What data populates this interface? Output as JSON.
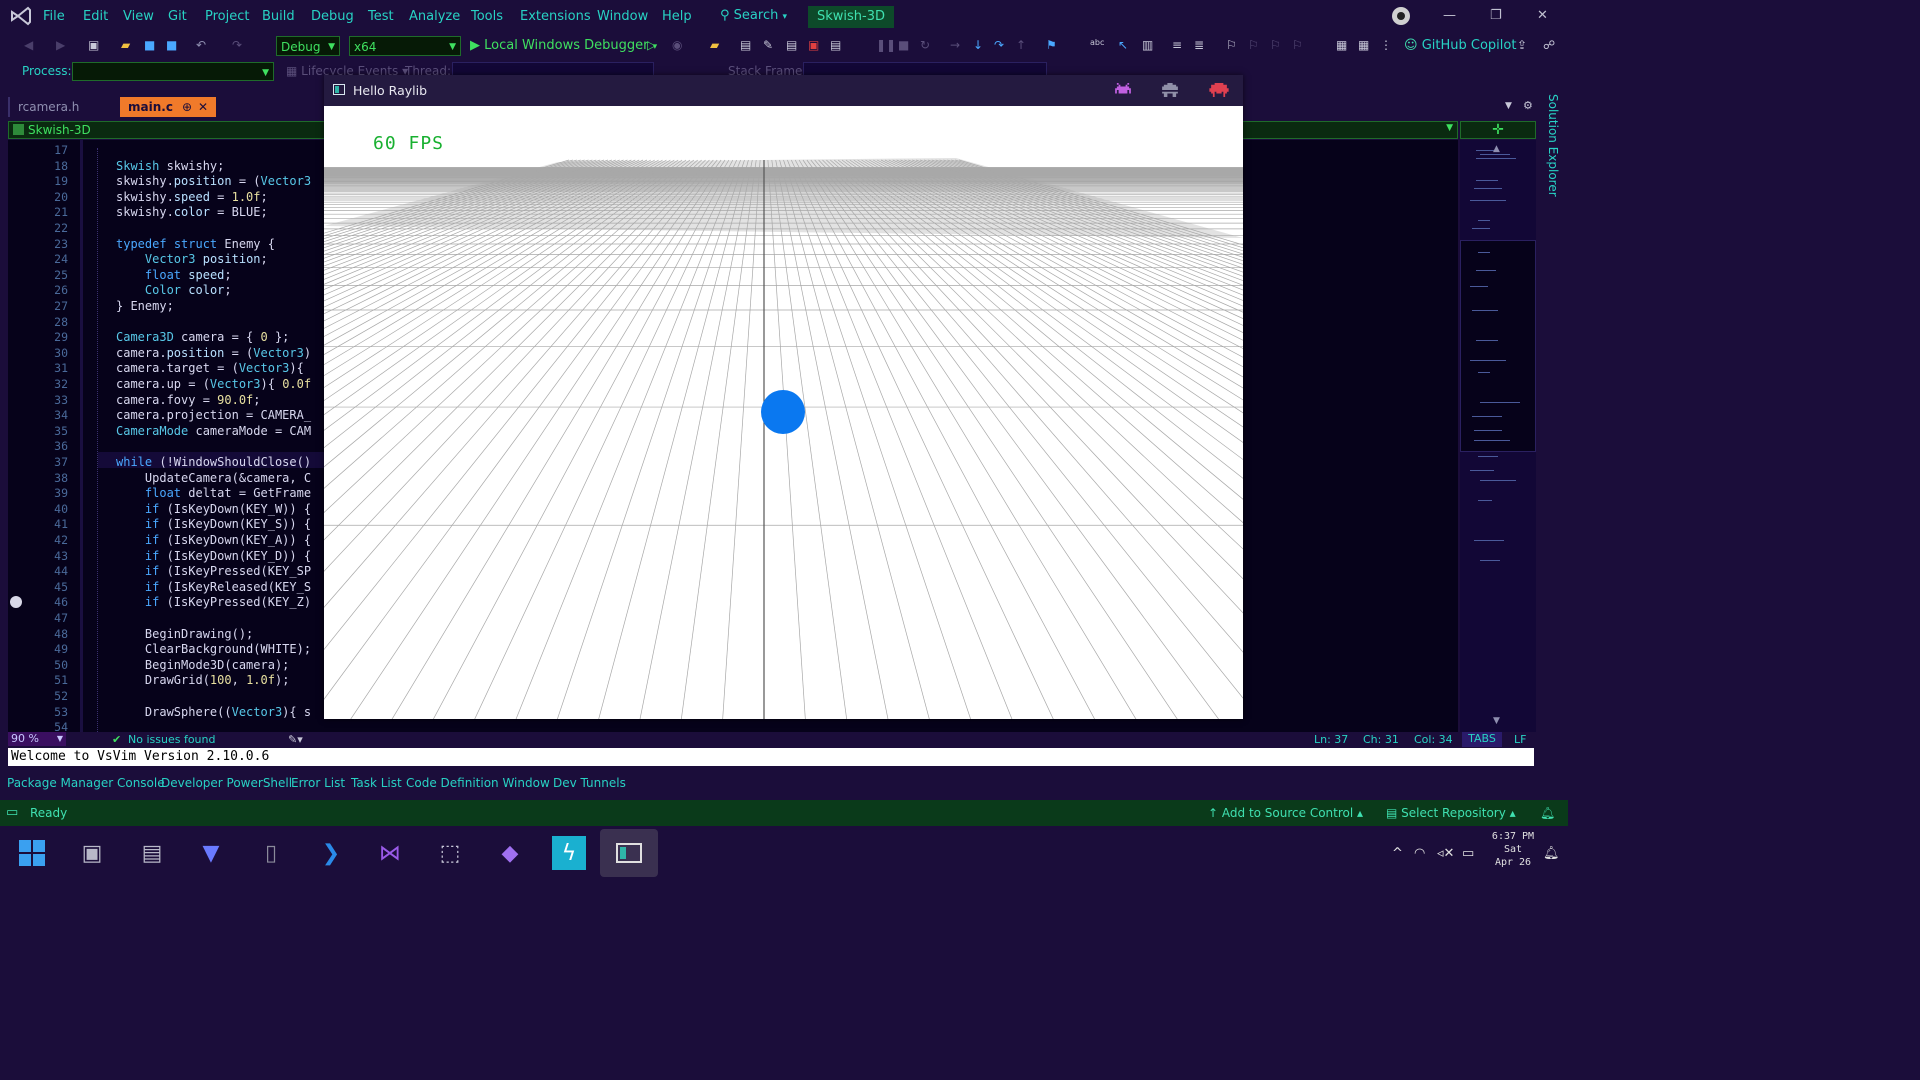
{
  "menubar": {
    "items": [
      "File",
      "Edit",
      "View",
      "Git",
      "Project",
      "Build",
      "Debug",
      "Test",
      "Analyze",
      "Tools",
      "Extensions",
      "Window",
      "Help"
    ],
    "search_label": "Search",
    "project_name": "Skwish-3D"
  },
  "toolbar": {
    "config": "Debug",
    "platform": "x64",
    "debugger": "Local Windows Debugger",
    "copilot": "GitHub Copilot"
  },
  "toolbar2": {
    "process_label": "Process:",
    "lifecycle_label": "Lifecycle Events",
    "thread_label": "Thread:",
    "stack_label": "Stack Frame:"
  },
  "tabs": [
    {
      "label": "rcamera.h"
    },
    {
      "label": "main.c"
    }
  ],
  "navbar": {
    "project": "Skwish-3D"
  },
  "editor": {
    "line_numbers": [
      "17",
      "18",
      "19",
      "20",
      "21",
      "22",
      "23",
      "24",
      "25",
      "26",
      "27",
      "28",
      "29",
      "30",
      "31",
      "32",
      "33",
      "34",
      "35",
      "36",
      "37",
      "38",
      "39",
      "40",
      "41",
      "42",
      "43",
      "44",
      "45",
      "46",
      "47",
      "48",
      "49",
      "50",
      "51",
      "52",
      "53",
      "54"
    ],
    "lines": [
      "",
      "Skwish skwishy;",
      "skwishy.position = (Vector3",
      "skwishy.speed = 1.0f;",
      "skwishy.color = BLUE;",
      "",
      "typedef struct Enemy {",
      "    Vector3 position;",
      "    float speed;",
      "    Color color;",
      "} Enemy;",
      "",
      "Camera3D camera = { 0 };",
      "camera.position = (Vector3)",
      "camera.target = (Vector3){",
      "camera.up = (Vector3){ 0.0f",
      "camera.fovy = 90.0f;",
      "camera.projection = CAMERA_",
      "CameraMode cameraMode = CAM",
      "",
      "while (!WindowShouldClose()",
      "    UpdateCamera(&camera, C",
      "    float deltat = GetFrame",
      "    if (IsKeyDown(KEY_W)) {",
      "    if (IsKeyDown(KEY_S)) {",
      "    if (IsKeyDown(KEY_A)) {",
      "    if (IsKeyDown(KEY_D)) {",
      "    if (IsKeyPressed(KEY_SP",
      "    if (IsKeyReleased(KEY_S",
      "    if (IsKeyPressed(KEY_Z)",
      "",
      "    BeginDrawing();",
      "    ClearBackground(WHITE);",
      "    BeginMode3D(camera);",
      "    DrawGrid(100, 1.0f);",
      "",
      "    DrawSphere((Vector3){ s",
      ""
    ]
  },
  "side_panel": {
    "solution_explorer": "Solution Explorer"
  },
  "statusrow": {
    "zoom": "90 %",
    "issues": "No issues found",
    "ln": "Ln: 37",
    "ch": "Ch: 31",
    "col": "Col: 34",
    "tabs": "TABS",
    "eol": "LF"
  },
  "vsvim_message": "Welcome to VsVim Version 2.10.0.6",
  "toolwindows": [
    "Package Manager Console",
    "Developer PowerShell",
    "Error List",
    "Task List",
    "Code Definition Window",
    "Dev Tunnels"
  ],
  "statusbar": {
    "ready": "Ready",
    "source_control": "Add to Source Control",
    "repository": "Select Repository"
  },
  "taskbar": {
    "time": "6:37 PM",
    "day": "Sat",
    "date": "Apr 26"
  },
  "raylib_window": {
    "title": "Hello Raylib",
    "fps": "60 FPS",
    "colors": {
      "sphere": "#0a78f0",
      "fps": "#18b030",
      "grid": "#a8a8a8"
    }
  },
  "colors": {
    "accent": "#28d2c4",
    "tab_active": "#f07a2a",
    "statusbar": "#0a3a1a"
  }
}
